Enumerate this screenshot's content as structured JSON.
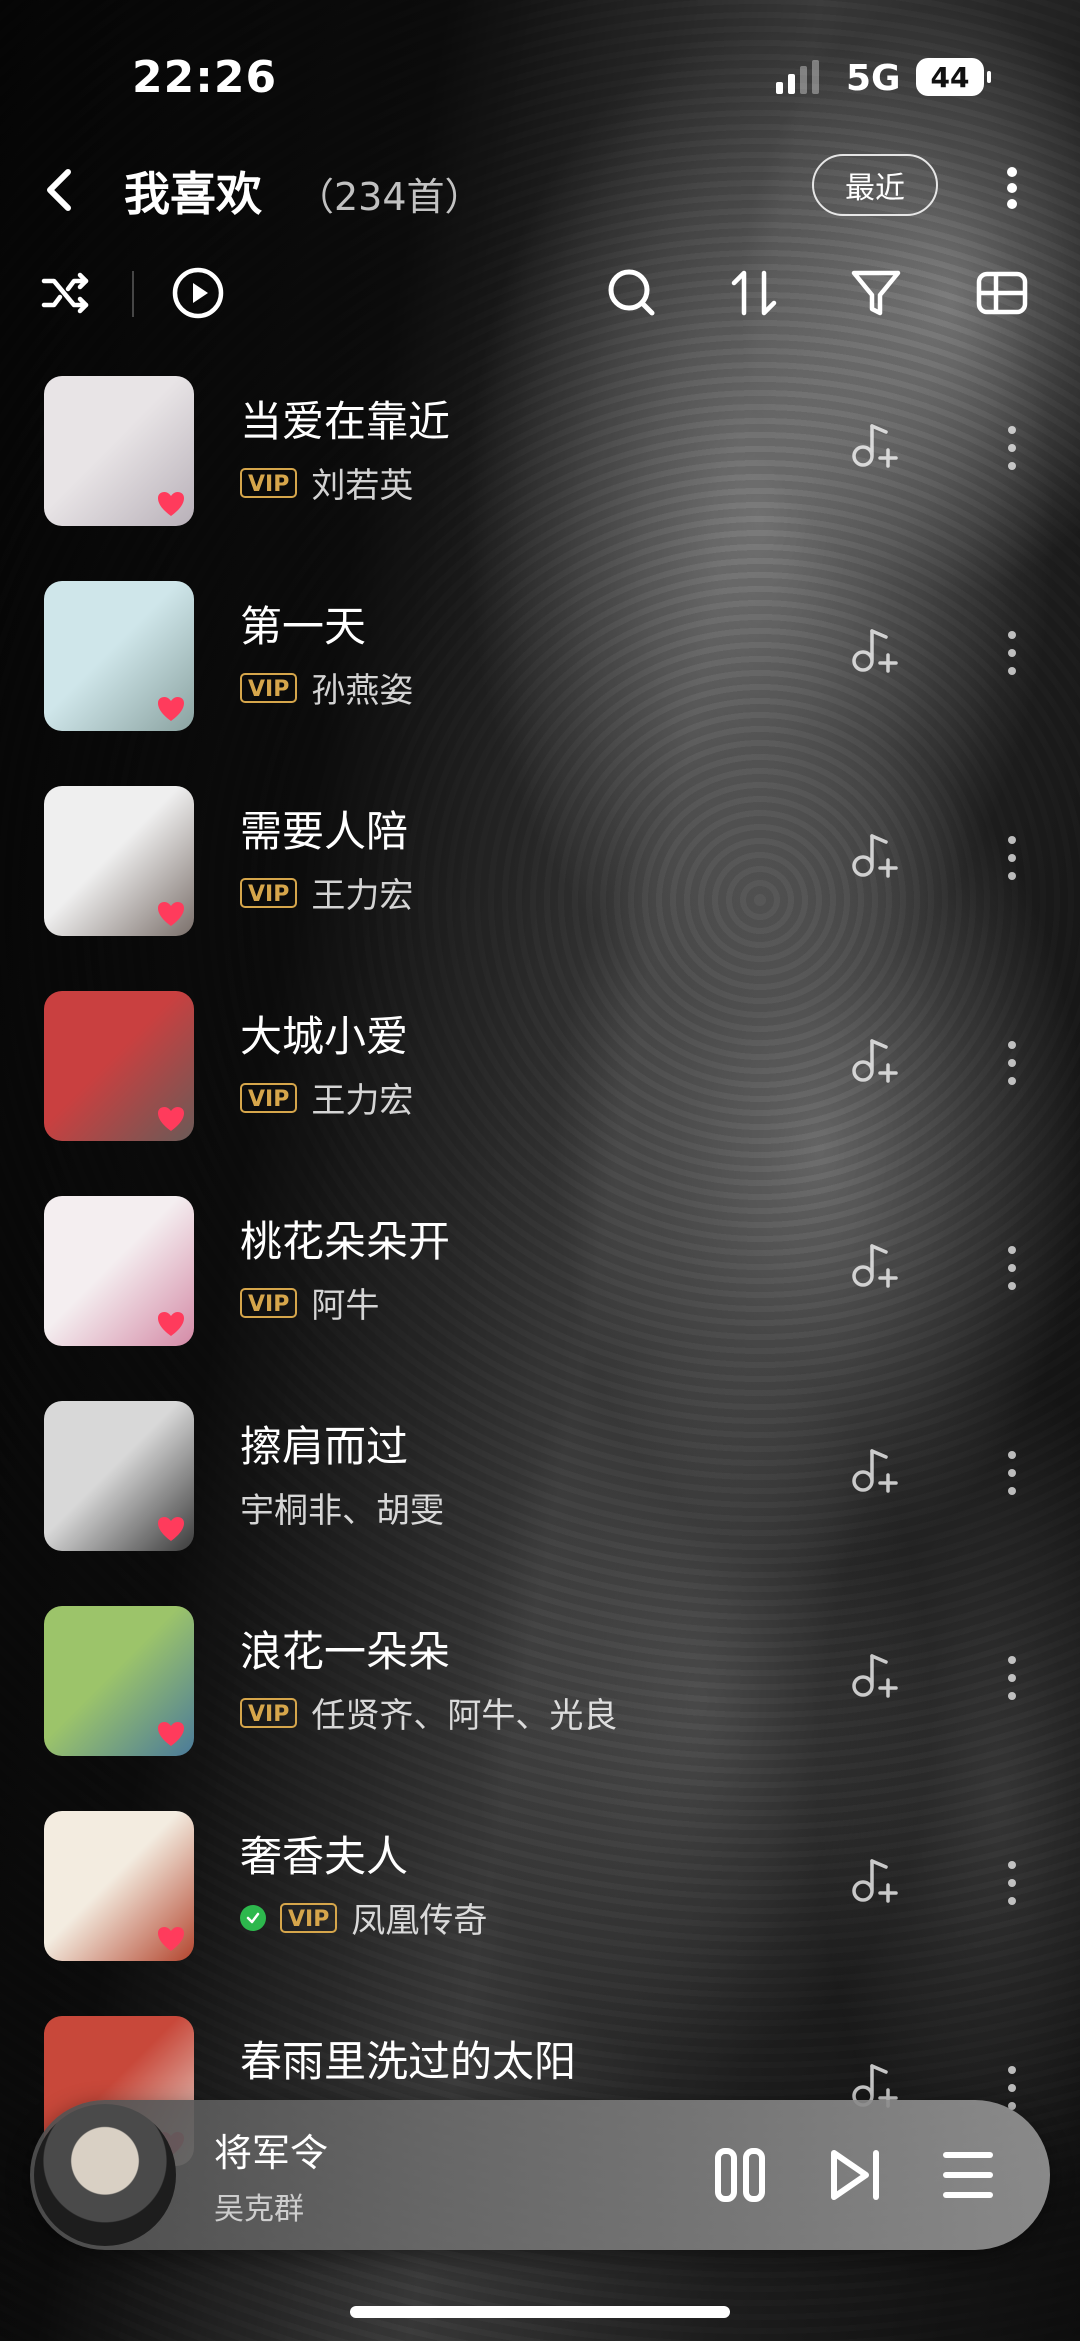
{
  "status_bar": {
    "time": "22:26",
    "network": "5G",
    "battery": "44"
  },
  "header": {
    "title": "我喜欢",
    "count": "（234首）",
    "recent_label": "最近"
  },
  "toolbar": {
    "icons": [
      "shuffle-icon",
      "play-circle-icon",
      "search-icon",
      "sort-icon",
      "filter-icon",
      "layout-icon"
    ]
  },
  "songs": [
    {
      "title": "当爱在靠近",
      "artist": "刘若英",
      "vip": "VIP",
      "verified": false,
      "cover_colors": [
        "#e8e4e6",
        "#b8b0b8"
      ]
    },
    {
      "title": "第一天",
      "artist": "孙燕姿",
      "vip": "VIP",
      "verified": false,
      "cover_colors": [
        "#cfe6ea",
        "#8aa2a0"
      ]
    },
    {
      "title": "需要人陪",
      "artist": "王力宏",
      "vip": "VIP",
      "verified": false,
      "cover_colors": [
        "#efefef",
        "#7a6f6a"
      ]
    },
    {
      "title": "大城小爱",
      "artist": "王力宏",
      "vip": "VIP",
      "verified": false,
      "cover_colors": [
        "#c94040",
        "#6a5a57"
      ]
    },
    {
      "title": "桃花朵朵开",
      "artist": "阿牛",
      "vip": "VIP",
      "verified": false,
      "cover_colors": [
        "#f4eef0",
        "#d48aa6"
      ]
    },
    {
      "title": "擦肩而过",
      "artist": "宇桐非、胡雯",
      "vip": "",
      "verified": false,
      "cover_colors": [
        "#d8d8d8",
        "#3a3a3a"
      ]
    },
    {
      "title": "浪花一朵朵",
      "artist": "任贤齐、阿牛、光良",
      "vip": "VIP",
      "verified": false,
      "cover_colors": [
        "#9cc46a",
        "#4a7a9a"
      ]
    },
    {
      "title": "奢香夫人",
      "artist": "凤凰传奇",
      "vip": "VIP",
      "verified": true,
      "cover_colors": [
        "#f3ece0",
        "#b3452e"
      ]
    },
    {
      "title": "春雨里洗过的太阳",
      "artist": "",
      "vip": "",
      "verified": false,
      "cover_colors": [
        "#c8483a",
        "#e8e0d8"
      ]
    }
  ],
  "player": {
    "title": "将军令",
    "artist": "吴克群"
  },
  "colors": {
    "vip": "#d6a64b",
    "heart": "#ff3b5c",
    "verified": "#2db84d"
  }
}
